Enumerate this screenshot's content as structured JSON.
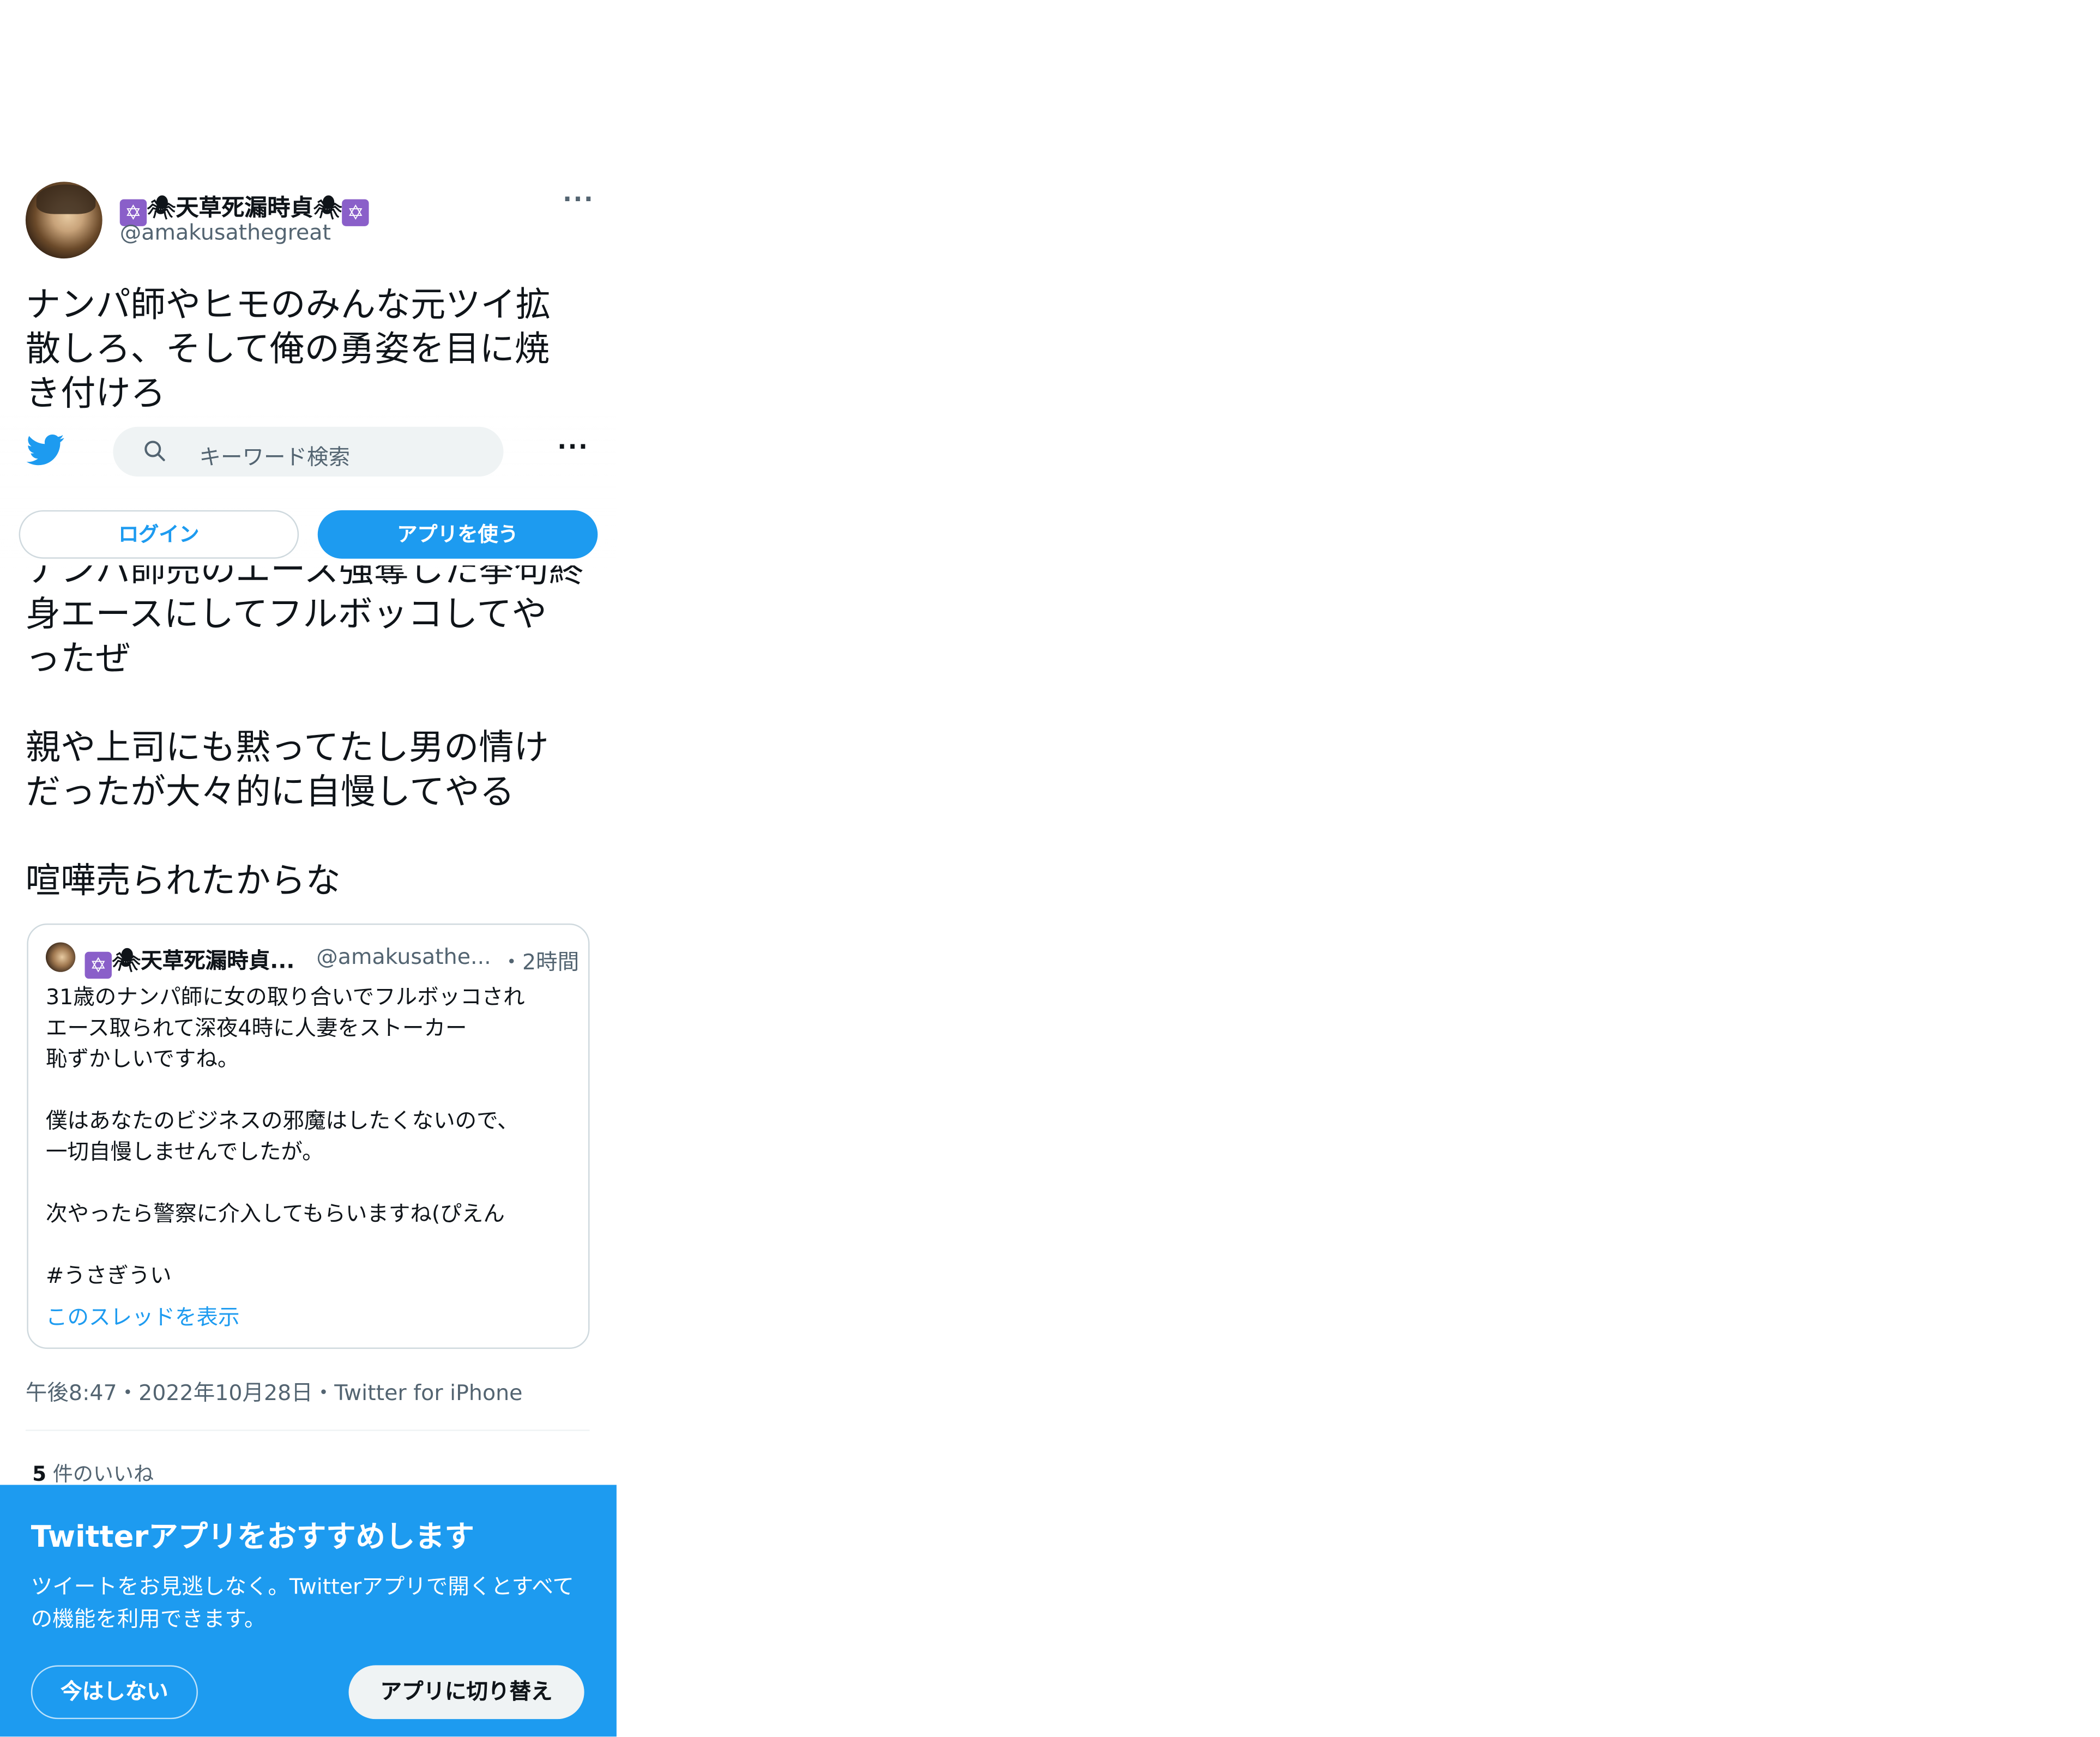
{
  "tweet": {
    "display_name_text": "天草死漏時貞",
    "handle": "@amakusathegreat",
    "more": "···",
    "text_top": "ナンパ師やヒモのみんな元ツイ拡\n散しろ、そして俺の勇姿を目に焼\nき付けろ",
    "text_partial": "ナンパ師売のエース強奪した挙句終",
    "text_bottom": "身エースにしてフルボッコしてや\nったぜ\n\n親や上司にも黙ってたし男の情け\nだったが大々的に自慢してやる\n\n喧嘩売られたからな",
    "timestamp": "午後8:47・2022年10月28日・Twitter for iPhone",
    "likes_count": "5",
    "likes_label": " 件のいいね"
  },
  "quoted": {
    "name": "天草死漏時貞...",
    "handle": "@amakusathe...",
    "time": "・2時間",
    "text": "31歳のナンパ師に女の取り合いでフルボッコされ\nエース取られて深夜4時に人妻をストーカー\n恥ずかしいですね。\n\n僕はあなたのビジネスの邪魔はしたくないので、\n一切自慢しませんでしたが。\n\n次やったら警察に介入してもらいますね(ぴえん\n\n#うさぎうい",
    "show_thread": "このスレッドを表示"
  },
  "topbar": {
    "search_placeholder": "キーワード検索",
    "more": "···",
    "login": "ログイン",
    "use_app": "アプリを使う"
  },
  "banner": {
    "title": "Twitterアプリをおすすめします",
    "description": "ツイートをお見逃しなく。Twitterアプリで開くとすべての機能を利用できます。",
    "not_now": "今はしない",
    "switch_app": "アプリに切り替え"
  },
  "colors": {
    "accent": "#1d9bf0",
    "text_primary": "#0f1419",
    "text_secondary": "#536471",
    "star_badge": "#8a5fc9"
  },
  "icons": [
    "twitter-bird-icon",
    "search-icon",
    "more-icon",
    "star-of-david-icon",
    "spider-icon"
  ]
}
